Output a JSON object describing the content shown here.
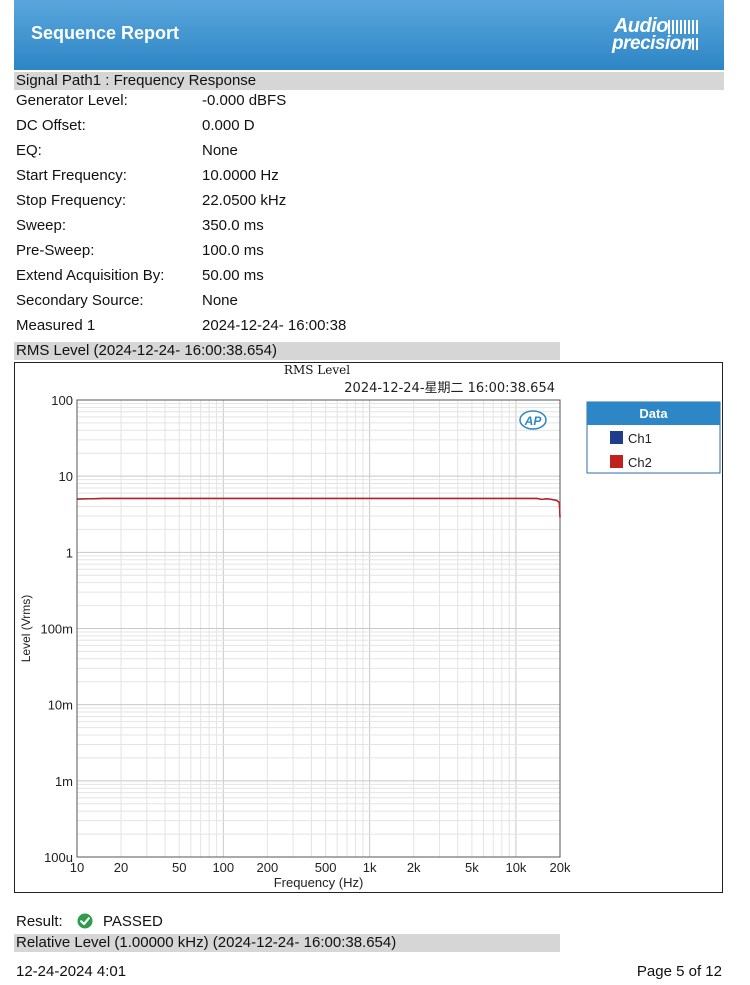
{
  "header": {
    "title": "Sequence Report",
    "logo_line1": "Audio",
    "logo_line2": "precision",
    "bg_color": "#3a90cc"
  },
  "section_signal_path": "Signal Path1 : Frequency Response",
  "params": [
    {
      "label": "Generator Level:",
      "value": "-0.000 dBFS"
    },
    {
      "label": "DC Offset:",
      "value": "0.000 D"
    },
    {
      "label": "EQ:",
      "value": "None"
    },
    {
      "label": "Start Frequency:",
      "value": "10.0000 Hz"
    },
    {
      "label": "Stop Frequency:",
      "value": "22.0500 kHz"
    },
    {
      "label": "Sweep:",
      "value": "350.0 ms"
    },
    {
      "label": "Pre-Sweep:",
      "value": "100.0 ms"
    },
    {
      "label": "Extend Acquisition By:",
      "value": "50.00 ms"
    },
    {
      "label": "Secondary Source:",
      "value": "None"
    },
    {
      "label": "Measured 1",
      "value": "2024-12-24- 16:00:38"
    }
  ],
  "section_rms": "RMS Level (2024-12-24- 16:00:38.654)",
  "chart_data": {
    "type": "line",
    "title": "RMS Level",
    "subtitle": "2024-12-24-星期二 16:00:38.654",
    "xlabel": "Frequency (Hz)",
    "ylabel": "Level (Vrms)",
    "x_scale": "log",
    "y_scale": "log",
    "xlim": [
      10,
      20000
    ],
    "ylim": [
      0.0001,
      100
    ],
    "x_ticks": [
      10,
      20,
      50,
      100,
      200,
      500,
      1000,
      2000,
      5000,
      10000,
      20000
    ],
    "x_tick_labels": [
      "10",
      "20",
      "50",
      "100",
      "200",
      "500",
      "1k",
      "2k",
      "5k",
      "10k",
      "20k"
    ],
    "y_ticks": [
      100,
      10,
      1,
      0.1,
      0.01,
      0.001,
      0.0001
    ],
    "y_tick_labels": [
      "100",
      "10",
      "1",
      "100m",
      "10m",
      "1m",
      "100u"
    ],
    "grid": true,
    "legend_title": "Data",
    "legend_position": "right",
    "logo_text": "AP",
    "series": [
      {
        "name": "Ch1",
        "color": "#1f3d8c",
        "x": [
          10,
          12,
          15,
          20,
          50,
          100,
          1000,
          10000,
          12000,
          14000,
          15000,
          16000,
          17000,
          18000,
          19000,
          19800,
          20000
        ],
        "y": [
          5.0,
          5.05,
          5.1,
          5.1,
          5.1,
          5.1,
          5.1,
          5.1,
          5.1,
          5.1,
          4.95,
          5.05,
          5.0,
          4.9,
          4.8,
          4.5,
          2.9
        ]
      },
      {
        "name": "Ch2",
        "color": "#c0201e",
        "x": [
          10,
          12,
          15,
          20,
          50,
          100,
          1000,
          10000,
          12000,
          14000,
          15000,
          16000,
          17000,
          18000,
          19000,
          19800,
          20000
        ],
        "y": [
          5.0,
          5.05,
          5.1,
          5.1,
          5.1,
          5.1,
          5.1,
          5.1,
          5.1,
          5.1,
          4.95,
          5.05,
          5.0,
          4.9,
          4.8,
          4.5,
          2.9
        ]
      }
    ]
  },
  "result": {
    "label": "Result:",
    "status": "PASSED",
    "status_color": "#2e9c4a"
  },
  "section_relative": "Relative Level (1.00000 kHz) (2024-12-24- 16:00:38.654)",
  "footer": {
    "date": "12-24-2024 4:01",
    "page": "Page 5 of 12"
  }
}
